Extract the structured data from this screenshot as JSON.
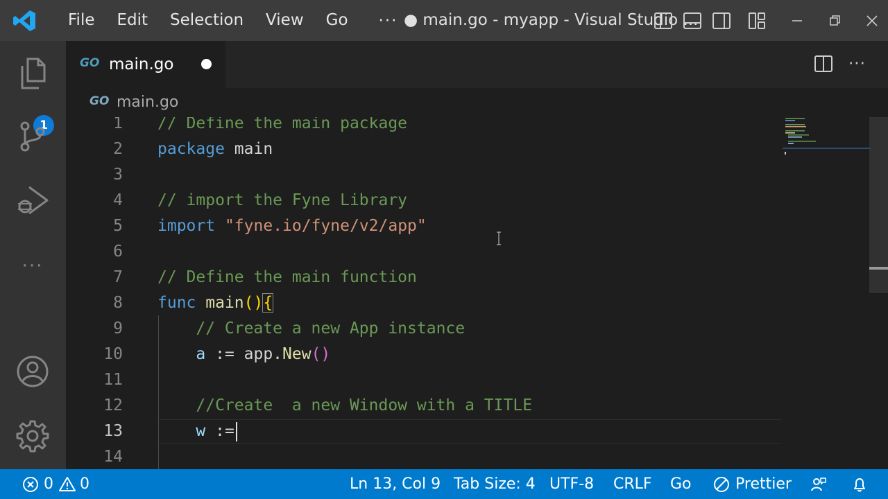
{
  "titlebar": {
    "menu": [
      "File",
      "Edit",
      "Selection",
      "View",
      "Go"
    ],
    "more": "···",
    "window_title": "● main.go - myapp - Visual Studio ..."
  },
  "activitybar": {
    "explorer_badge": "1",
    "items": [
      "files-icon",
      "source-control-icon",
      "run-debug-icon",
      "ellipsis-icon",
      "account-icon",
      "gear-icon"
    ],
    "more": "···"
  },
  "tabs": [
    {
      "icon_label": "GO",
      "label": "main.go",
      "dirty": true
    }
  ],
  "editor_actions": {
    "more": "···"
  },
  "breadcrumb": {
    "icon_label": "GO",
    "label": "main.go"
  },
  "editor": {
    "active_line": 13,
    "lines": [
      {
        "n": "1",
        "tokens": [
          [
            "com",
            "// Define the main package"
          ]
        ]
      },
      {
        "n": "2",
        "tokens": [
          [
            "kw",
            "package"
          ],
          [
            "id",
            " main"
          ]
        ]
      },
      {
        "n": "3",
        "tokens": []
      },
      {
        "n": "4",
        "tokens": [
          [
            "com",
            "// import the Fyne Library"
          ]
        ]
      },
      {
        "n": "5",
        "tokens": [
          [
            "kw",
            "import"
          ],
          [
            "id",
            " "
          ],
          [
            "str",
            "\"fyne.io/fyne/v2/app\""
          ]
        ]
      },
      {
        "n": "6",
        "tokens": []
      },
      {
        "n": "7",
        "tokens": [
          [
            "com",
            "// Define the main function"
          ]
        ]
      },
      {
        "n": "8",
        "tokens": [
          [
            "kw",
            "func"
          ],
          [
            "id",
            " "
          ],
          [
            "fn",
            "main"
          ],
          [
            "b1",
            "()"
          ],
          [
            "b1box",
            "{"
          ]
        ]
      },
      {
        "n": "9",
        "tokens": [
          [
            "id",
            "    "
          ],
          [
            "com",
            "// Create a new App instance"
          ]
        ]
      },
      {
        "n": "10",
        "tokens": [
          [
            "id",
            "    "
          ],
          [
            "var",
            "a"
          ],
          [
            "op",
            " := "
          ],
          [
            "id",
            "app."
          ],
          [
            "fn",
            "New"
          ],
          [
            "b2",
            "()"
          ]
        ]
      },
      {
        "n": "11",
        "tokens": []
      },
      {
        "n": "12",
        "tokens": [
          [
            "id",
            "    "
          ],
          [
            "com",
            "//Create  a new Window with a TITLE"
          ]
        ]
      },
      {
        "n": "13",
        "tokens": [
          [
            "id",
            "    "
          ],
          [
            "var",
            "w"
          ],
          [
            "op",
            " :="
          ]
        ]
      },
      {
        "n": "14",
        "tokens": []
      }
    ]
  },
  "statusbar": {
    "errors": "0",
    "warnings": "0",
    "position": "Ln 13, Col 9",
    "tab_size": "Tab Size: 4",
    "encoding": "UTF-8",
    "eol": "CRLF",
    "language": "Go",
    "formatter": "Prettier"
  },
  "colors": {
    "titlebar": "#3c3c3c",
    "activitybar": "#333333",
    "editor_bg": "#1e1e1e",
    "statusbar": "#007acc",
    "accent": "#0e7bd6"
  }
}
